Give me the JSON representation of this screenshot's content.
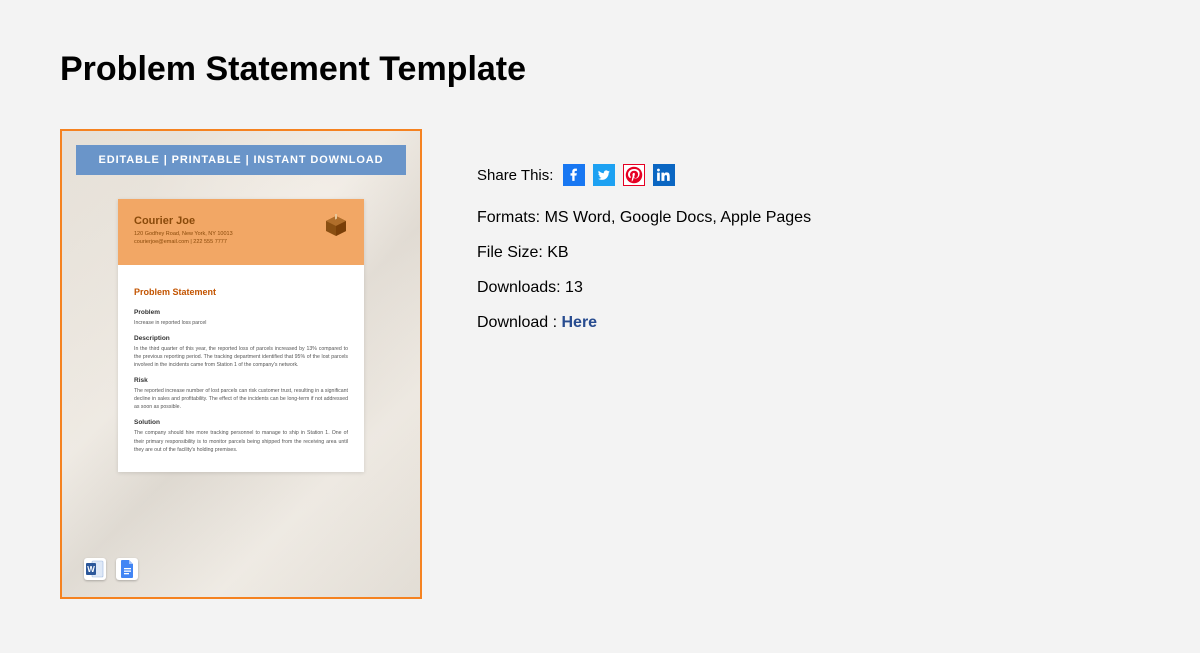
{
  "page_title": "Problem Statement Template",
  "preview": {
    "banner": "EDITABLE  |  PRINTABLE  |  INSTANT DOWNLOAD",
    "brand": {
      "name": "Courier Joe",
      "address": "120 Godfrey Road, New York, NY 10013",
      "contact": "courierjoe@email.com | 222 555 7777"
    },
    "doc_title": "Problem Statement",
    "sections": {
      "problem_h": "Problem",
      "problem_p": "Increase in reported loss parcel",
      "desc_h": "Description",
      "desc_p": "In the third quarter of this year, the reported loss of parcels increased by 13% compared to the previous reporting period. The tracking department identified that 95% of the lost parcels involved in the incidents came from Station 1 of the company's network.",
      "risk_h": "Risk",
      "risk_p": "The reported increase number of lost parcels can risk customer trust, resulting in a significant decline in sales and profitability. The effect of the incidents can be long-term if not addressed as soon as possible.",
      "sol_h": "Solution",
      "sol_p": "The company should hire more tracking personnel to manage to ship in Station 1. One of their primary responsibility is to monitor parcels being shipped from the receiving area until they are out of the facility's holding premises."
    }
  },
  "details": {
    "share_label": "Share This:",
    "formats": "Formats: MS Word, Google Docs, Apple Pages",
    "file_size": "File Size: KB",
    "downloads": "Downloads: 13",
    "download_label": "Download : ",
    "download_link": "Here"
  }
}
